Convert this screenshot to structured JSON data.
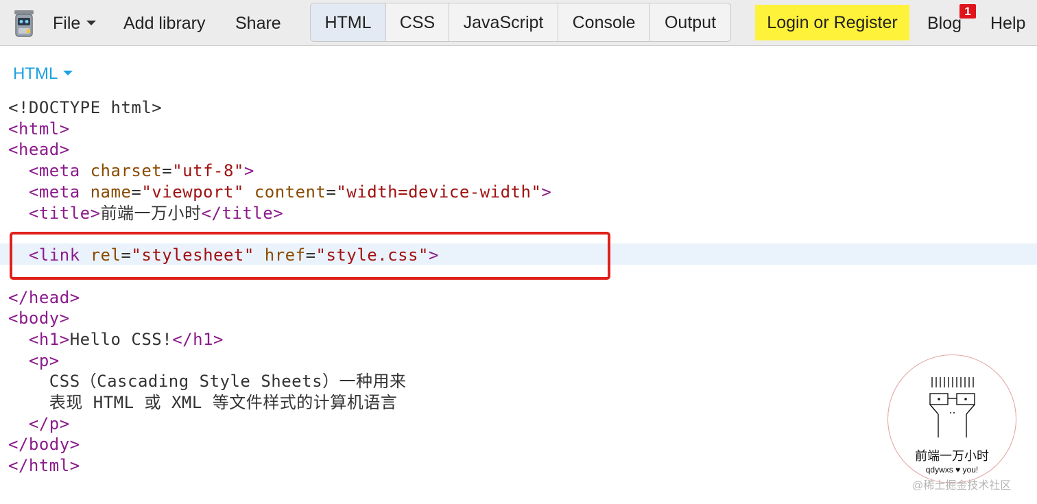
{
  "topbar": {
    "menu": {
      "file_label": "File",
      "add_library_label": "Add library",
      "share_label": "Share"
    },
    "tabs": [
      {
        "label": "HTML",
        "active": true
      },
      {
        "label": "CSS",
        "active": false
      },
      {
        "label": "JavaScript",
        "active": false
      },
      {
        "label": "Console",
        "active": false
      },
      {
        "label": "Output",
        "active": false
      }
    ],
    "login_label": "Login or Register",
    "blog_label": "Blog",
    "blog_badge": "1",
    "help_label": "Help",
    "colors": {
      "login_bg": "#fff23a",
      "badge_bg": "#e0141b",
      "active_tab_bg": "#e3eaf3"
    }
  },
  "panel": {
    "language_label": "HTML",
    "accent_color": "#1ba1e2"
  },
  "code": {
    "line1": {
      "p1": "<!DOCTYPE html>"
    },
    "line2": {
      "tag": "<html>"
    },
    "line3": {
      "tag": "<head>"
    },
    "line4": {
      "t1": "<meta",
      "a1": "charset",
      "eq1": "=",
      "v1": "\"utf-8\"",
      "t2": ">"
    },
    "line5": {
      "t1": "<meta",
      "a1": "name",
      "eq1": "=",
      "v1": "\"viewport\"",
      "a2": "content",
      "eq2": "=",
      "v2": "\"width=device-width\"",
      "t2": ">"
    },
    "line6": {
      "t1": "<title>",
      "text": "前端一万小时",
      "t2": "</title>"
    },
    "line7": {
      "t1": "<link",
      "a1": "rel",
      "eq1": "=",
      "v1": "\"stylesheet\"",
      "a2": "href",
      "eq2": "=",
      "v2": "\"style.css\"",
      "t2": ">"
    },
    "line8": {
      "tag": "</head>"
    },
    "line9": {
      "tag": "<body>"
    },
    "line10": {
      "t1": "<h1>",
      "text": "Hello CSS!",
      "t2": "</h1>"
    },
    "line11": {
      "tag": "<p>"
    },
    "line12": {
      "text": "CSS（Cascading Style Sheets）一种用来"
    },
    "line13": {
      "text": "表现 HTML 或 XML 等文件样式的计算机语言"
    },
    "line14": {
      "tag": "</p>"
    },
    "line15": {
      "tag": "</body>"
    },
    "line16": {
      "tag": "</html>"
    },
    "highlight_color": "#e0201b"
  },
  "stamp": {
    "title": "前端一万小时",
    "subtitle": "qdywxs ♥ you!"
  },
  "watermark": "@稀土掘金技术社区"
}
